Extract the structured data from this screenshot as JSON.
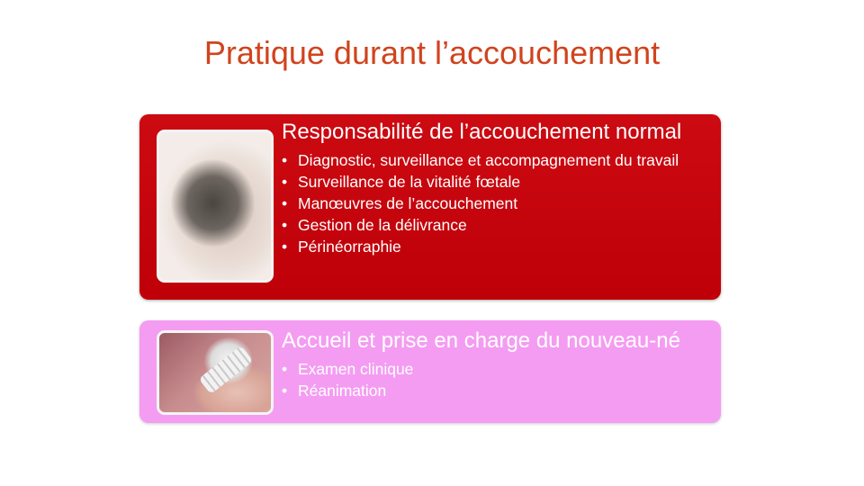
{
  "slide": {
    "title": "Pratique durant l’accouchement"
  },
  "cards": [
    {
      "heading": "Responsabilité de l’accouchement normal",
      "bullets": [
        "Diagnostic, surveillance et accompagnement du travail",
        "Surveillance de la vitalité fœtale",
        "Manœuvres de l’accouchement",
        "Gestion de la délivrance",
        "Périnéorraphie"
      ],
      "color": "#c4000a"
    },
    {
      "heading": "Accueil et prise en charge du nouveau-né",
      "bullets": [
        "Examen clinique",
        "Réanimation"
      ],
      "color": "#f49cf2"
    }
  ],
  "colors": {
    "title": "#d0441e",
    "text_on_cards": "#ffffff"
  },
  "icons": {
    "bullet": "•"
  }
}
